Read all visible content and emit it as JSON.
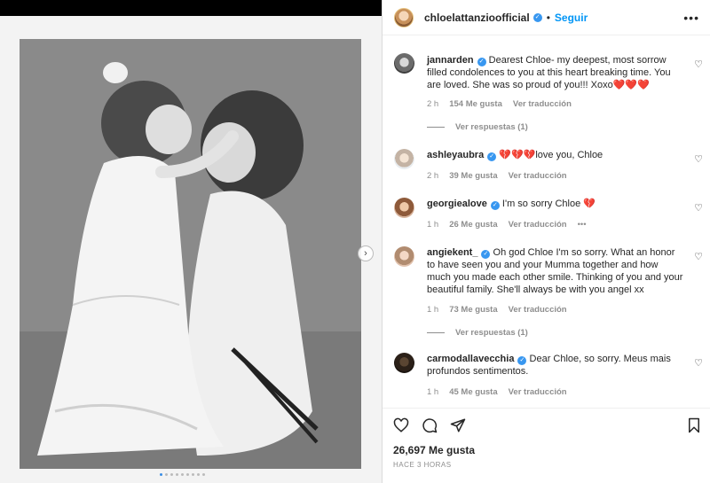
{
  "post": {
    "username": "chloelattanzioofficial",
    "follow_label": "Seguir",
    "more_label": "•••",
    "verified_glyph": "✓",
    "separator": "•"
  },
  "comments": [
    {
      "username": "jannarden",
      "text": "Dearest Chloe- my deepest, most sorrow filled condolences to you at this heart breaking time. You are loved. She was so proud of you!!! Xoxo❤️❤️❤️",
      "time": "2 h",
      "likes": "154 Me gusta",
      "translate": "Ver traducción",
      "replies": "Ver respuestas (1)"
    },
    {
      "username": "ashleyaubra",
      "text": "💔💔💔love you, Chloe",
      "time": "2 h",
      "likes": "39 Me gusta",
      "translate": "Ver traducción"
    },
    {
      "username": "georgiealove",
      "text": "I'm so sorry Chloe 💔",
      "time": "1 h",
      "likes": "26 Me gusta",
      "translate": "Ver traducción",
      "more": "•••"
    },
    {
      "username": "angiekent_",
      "text": "Oh god Chloe I'm so sorry. What an honor to have seen you and your Mumma together and how much you made each other smile. Thinking of you and your beautiful family. She'll always be with you angel xx",
      "time": "1 h",
      "likes": "73 Me gusta",
      "translate": "Ver traducción",
      "replies": "Ver respuestas (1)"
    },
    {
      "username": "carmodallavecchia",
      "text": "Dear Chloe, so sorry. Meus mais profundos sentimentos.",
      "time": "1 h",
      "likes": "45 Me gusta",
      "translate": "Ver traducción"
    }
  ],
  "footer": {
    "likes_total": "26,697 Me gusta",
    "posted_ago": "HACE 3 HORAS"
  },
  "carousel": {
    "next_glyph": "›",
    "active_index": 0,
    "count": 9
  },
  "icons": {
    "like": "heart-icon",
    "comment": "comment-icon",
    "share": "share-icon",
    "save": "bookmark-icon",
    "comment_like": "heart-icon"
  }
}
